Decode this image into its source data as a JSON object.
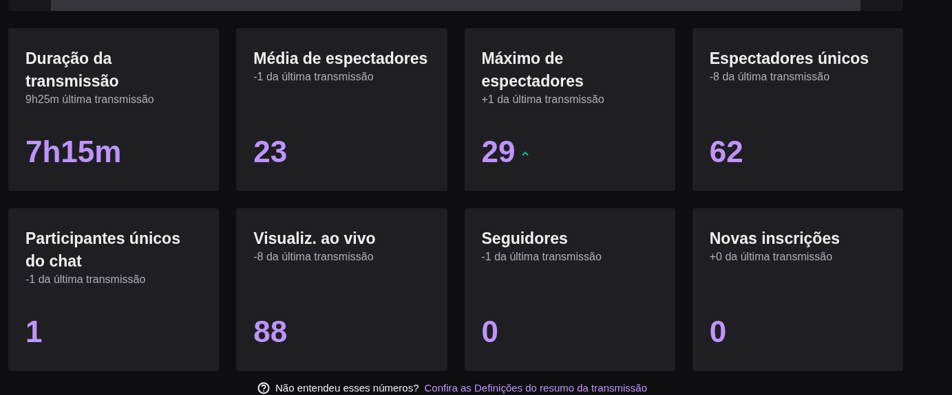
{
  "stats": [
    {
      "title": "Duração da transmissão",
      "comparison": "9h25m última transmissão",
      "value": "7h15m",
      "trending_up": false
    },
    {
      "title": "Média de espectadores",
      "comparison": "-1 da última transmissão",
      "value": "23",
      "trending_up": false
    },
    {
      "title": "Máximo de espectadores",
      "comparison": "+1 da última transmissão",
      "value": "29",
      "trending_up": true
    },
    {
      "title": "Espectadores únicos",
      "comparison": "-8 da última transmissão",
      "value": "62",
      "trending_up": false
    },
    {
      "title": "Participantes únicos do chat",
      "comparison": "-1 da última transmissão",
      "value": "1",
      "trending_up": false
    },
    {
      "title": "Visualiz. ao vivo",
      "comparison": "-8 da última transmissão",
      "value": "88",
      "trending_up": false
    },
    {
      "title": "Seguidores",
      "comparison": "-1 da última transmissão",
      "value": "0",
      "trending_up": false
    },
    {
      "title": "Novas inscrições",
      "comparison": "+0 da última transmissão",
      "value": "0",
      "trending_up": false
    }
  ],
  "help": {
    "text": "Não entendeu esses números?",
    "link": "Confira as Definições do resumo da transmissão"
  }
}
